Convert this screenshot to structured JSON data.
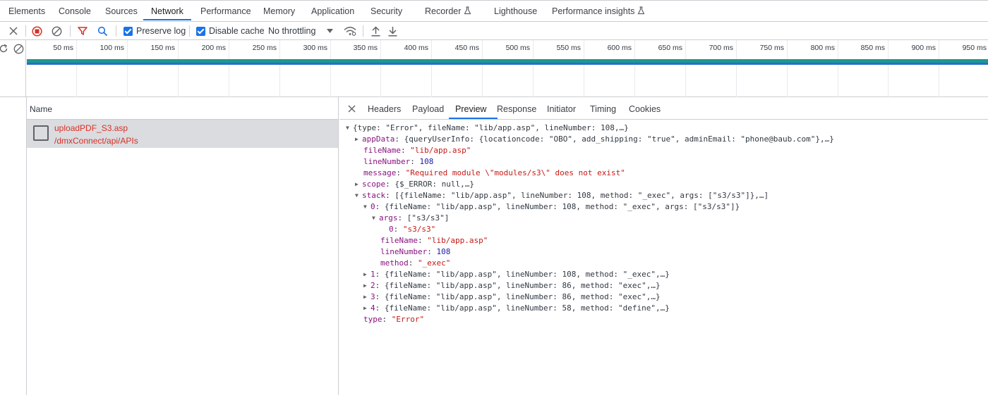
{
  "main_tabs": [
    "Elements",
    "Console",
    "Sources",
    "Network",
    "Performance",
    "Memory",
    "Application",
    "Security",
    "Recorder",
    "Lighthouse",
    "Performance insights"
  ],
  "active_tab": "Network",
  "toolbar": {
    "preserve_log": "Preserve log",
    "disable_cache": "Disable cache",
    "throttling": "No throttling"
  },
  "timeline_ticks": [
    "50 ms",
    "100 ms",
    "150 ms",
    "200 ms",
    "250 ms",
    "300 ms",
    "350 ms",
    "400 ms",
    "450 ms",
    "500 ms",
    "550 ms",
    "600 ms",
    "650 ms",
    "700 ms",
    "750 ms",
    "800 ms",
    "850 ms",
    "900 ms",
    "950 ms"
  ],
  "request_list": {
    "header": "Name",
    "rows": [
      {
        "name": "uploadPDF_S3.asp",
        "path": "/dmxConnect/api/APIs"
      }
    ]
  },
  "detail_tabs": [
    "Headers",
    "Payload",
    "Preview",
    "Response",
    "Initiator",
    "Timing",
    "Cookies"
  ],
  "active_detail_tab": "Preview",
  "preview": {
    "root": "{type: \"Error\", fileName: \"lib/app.asp\", lineNumber: 108,…}",
    "appData_key": "appData",
    "appData_val": "{queryUserInfo: {locationcode: \"OBO\", add_shipping: \"true\", adminEmail: \"phone@baub.com\"},…}",
    "fileName_key": "fileName",
    "fileName_val": "\"lib/app.asp\"",
    "lineNumber_key": "lineNumber",
    "lineNumber_val": "108",
    "message_key": "message",
    "message_val": "\"Required module \\\"modules/s3\\\" does not exist\"",
    "scope_key": "scope",
    "scope_val": "{$_ERROR: null,…}",
    "stack_key": "stack",
    "stack_val": "[{fileName: \"lib/app.asp\", lineNumber: 108, method: \"_exec\", args: [\"s3/s3\"]},…]",
    "s0_key": "0",
    "s0_val": "{fileName: \"lib/app.asp\", lineNumber: 108, method: \"_exec\", args: [\"s3/s3\"]}",
    "args_key": "args",
    "args_val": "[\"s3/s3\"]",
    "args0_key": "0",
    "args0_val": "\"s3/s3\"",
    "s0_fileName_key": "fileName",
    "s0_fileName_val": "\"lib/app.asp\"",
    "s0_lineNumber_key": "lineNumber",
    "s0_lineNumber_val": "108",
    "s0_method_key": "method",
    "s0_method_val": "\"_exec\"",
    "s1_key": "1",
    "s1_val": "{fileName: \"lib/app.asp\", lineNumber: 108, method: \"_exec\",…}",
    "s2_key": "2",
    "s2_val": "{fileName: \"lib/app.asp\", lineNumber: 86, method: \"exec\",…}",
    "s3_key": "3",
    "s3_val": "{fileName: \"lib/app.asp\", lineNumber: 86, method: \"exec\",…}",
    "s4_key": "4",
    "s4_val": "{fileName: \"lib/app.asp\", lineNumber: 58, method: \"define\",…}",
    "type_key": "type",
    "type_val": "\"Error\""
  },
  "icons": [
    "close-icon",
    "record-stop-icon",
    "clear-icon",
    "filter-icon",
    "search-icon",
    "dropdown-arrow-icon",
    "network-conditions-icon",
    "upload-icon",
    "download-icon",
    "reload-icon",
    "block-icon",
    "flask-icon",
    "document-icon",
    "expand-triangle-icon",
    "collapse-triangle-icon"
  ],
  "colors": {
    "accent": "#1a73e8",
    "error": "#d93025",
    "teal": "#1a9a8c",
    "blue": "#2e6ad1"
  }
}
